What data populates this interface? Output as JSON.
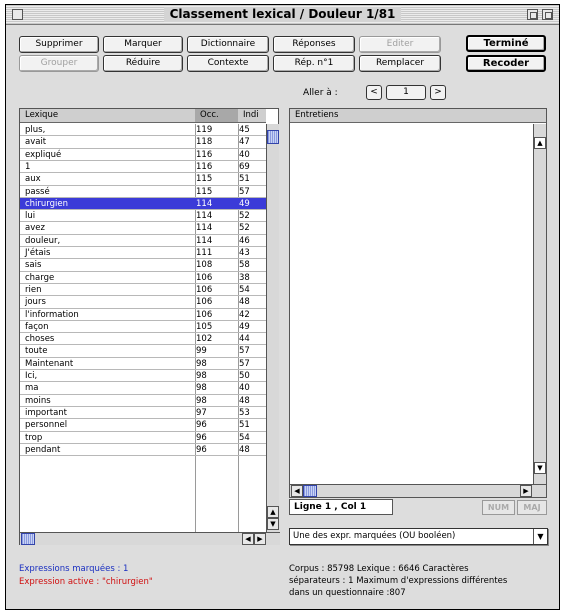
{
  "window": {
    "title": "Classement lexical / Douleur 1/81"
  },
  "toolbar": {
    "row1": [
      {
        "label": "Supprimer",
        "enabled": true
      },
      {
        "label": "Marquer",
        "enabled": true
      },
      {
        "label": "Dictionnaire",
        "enabled": true
      },
      {
        "label": "Réponses",
        "enabled": true
      },
      {
        "label": "Editer",
        "enabled": false
      }
    ],
    "row2": [
      {
        "label": "Grouper",
        "enabled": false
      },
      {
        "label": "Réduire",
        "enabled": true
      },
      {
        "label": "Contexte",
        "enabled": true
      },
      {
        "label": "Rép. n°1",
        "enabled": true
      },
      {
        "label": "Remplacer",
        "enabled": true
      }
    ],
    "done_label": "Terminé",
    "recode_label": "Recoder"
  },
  "navigation": {
    "label": "Aller à :",
    "prev": "<",
    "page": "1",
    "next": ">"
  },
  "lexicon": {
    "columns": [
      "Lexique",
      "Occ.",
      "Indi"
    ],
    "selected_index": 6,
    "rows": [
      [
        "plus,",
        "119",
        "45"
      ],
      [
        "avait",
        "118",
        "47"
      ],
      [
        "expliqué",
        "116",
        "40"
      ],
      [
        "1",
        "116",
        "69"
      ],
      [
        "aux",
        "115",
        "51"
      ],
      [
        "passé",
        "115",
        "57"
      ],
      [
        "chirurgien",
        "114",
        "49"
      ],
      [
        "lui",
        "114",
        "52"
      ],
      [
        "avez",
        "114",
        "52"
      ],
      [
        "douleur,",
        "114",
        "46"
      ],
      [
        "J'étais",
        "111",
        "43"
      ],
      [
        "sais",
        "108",
        "58"
      ],
      [
        "charge",
        "106",
        "38"
      ],
      [
        "rien",
        "106",
        "54"
      ],
      [
        "jours",
        "106",
        "48"
      ],
      [
        "l'information",
        "106",
        "42"
      ],
      [
        "façon",
        "105",
        "49"
      ],
      [
        "choses",
        "102",
        "44"
      ],
      [
        "toute",
        "99",
        "57"
      ],
      [
        "Maintenant",
        "98",
        "57"
      ],
      [
        "Ici,",
        "98",
        "50"
      ],
      [
        "ma",
        "98",
        "40"
      ],
      [
        "moins",
        "98",
        "48"
      ],
      [
        "important",
        "97",
        "53"
      ],
      [
        "personnel",
        "96",
        "51"
      ],
      [
        "trop",
        "96",
        "54"
      ],
      [
        "pendant",
        "96",
        "48"
      ]
    ]
  },
  "entretiens": {
    "header": "Entretiens",
    "cursor": "Ligne 1 , Col 1",
    "indicators": [
      "NUM",
      "MAJ"
    ],
    "filter_selected": "Une des expr. marquées (OU booléen)"
  },
  "status": {
    "marked_expressions": "Expressions marquées : 1",
    "active_expression": "Expression active : \"chirurgien\"",
    "corpus_line1": "Corpus : 85798  Lexique : 6646   Caractères",
    "corpus_line2": "séparateurs : 1   Maximum d'expressions différentes",
    "corpus_line3": "dans un questionnaire :807"
  },
  "colors": {
    "selection": "#3b3bd8",
    "marked": "#1a2fc0",
    "active": "#d01010"
  }
}
